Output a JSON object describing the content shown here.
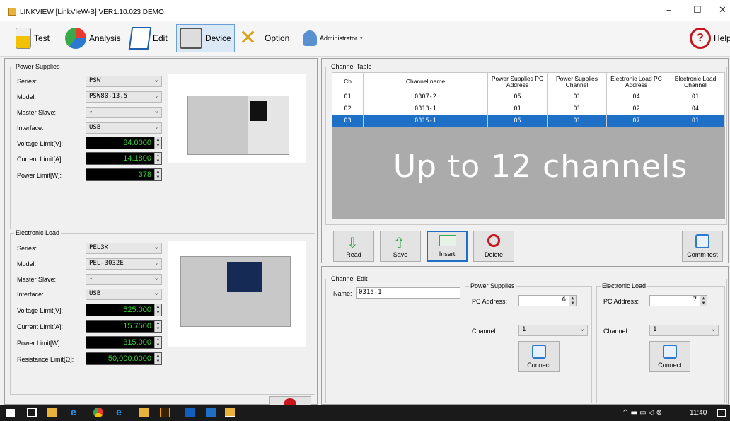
{
  "window": {
    "title": "LINKVIEW [LinkVIeW-B] VER1.10.023 DEMO",
    "min": "–",
    "max": "☐",
    "close": "✕"
  },
  "toolbar": {
    "test": "Test",
    "analysis": "Analysis",
    "edit": "Edit",
    "device": "Device",
    "option": "Option",
    "admin": "Administrator",
    "help": "Help"
  },
  "ps": {
    "group": "Power Supplies",
    "series_l": "Series:",
    "series": "PSW",
    "model_l": "Model:",
    "model": "PSW80-13.5",
    "ms_l": "Master Slave:",
    "ms": "-",
    "if_l": "Interface:",
    "if": "USB",
    "v_l": "Voltage Limit[V]:",
    "v": "84.0000",
    "c_l": "Current Limit[A]:",
    "c": "14.1800",
    "p_l": "Power Limit[W]:",
    "p": "378"
  },
  "el": {
    "group": "Electronic Load",
    "series_l": "Series:",
    "series": "PEL3K",
    "model_l": "Model:",
    "model": "PEL-3032E",
    "ms_l": "Master Slave:",
    "ms": "-",
    "if_l": "Interface:",
    "if": "USB",
    "v_l": "Voltage Limit[V]:",
    "v": "525.000",
    "c_l": "Current Limit[A]:",
    "c": "15.7500",
    "p_l": "Power Limit[W]:",
    "p": "315.000",
    "r_l": "Resistance Limit[Ω]:",
    "r": "50,000.0000"
  },
  "table": {
    "group": "Channel Table",
    "headers": [
      "Ch",
      "Channel name",
      "Power Supplies PC Address",
      "Power Supplies Channel",
      "Electronic Load PC Address",
      "Electronic Load Channel"
    ],
    "rows": [
      [
        "01",
        "0307-2",
        "05",
        "01",
        "04",
        "01"
      ],
      [
        "02",
        "0313-1",
        "01",
        "01",
        "02",
        "04"
      ],
      [
        "03",
        "0315-1",
        "06",
        "01",
        "07",
        "01"
      ]
    ],
    "overlay": "Up to 12 channels"
  },
  "actions": {
    "read": "Read",
    "save": "Save",
    "insert": "Insert",
    "delete": "Delete",
    "comm": "Comm test"
  },
  "edit": {
    "group": "Channel Edit",
    "name_l": "Name:",
    "name": "0315-1",
    "ps": {
      "group": "Power Supplies",
      "pc_l": "PC Address:",
      "pc": "6",
      "ch_l": "Channel:",
      "ch": "1",
      "connect": "Connect"
    },
    "el": {
      "group": "Electronic Load",
      "pc_l": "PC Address:",
      "pc": "7",
      "ch_l": "Channel:",
      "ch": "1",
      "connect": "Connect"
    }
  },
  "taskbar": {
    "time": "11:40"
  }
}
